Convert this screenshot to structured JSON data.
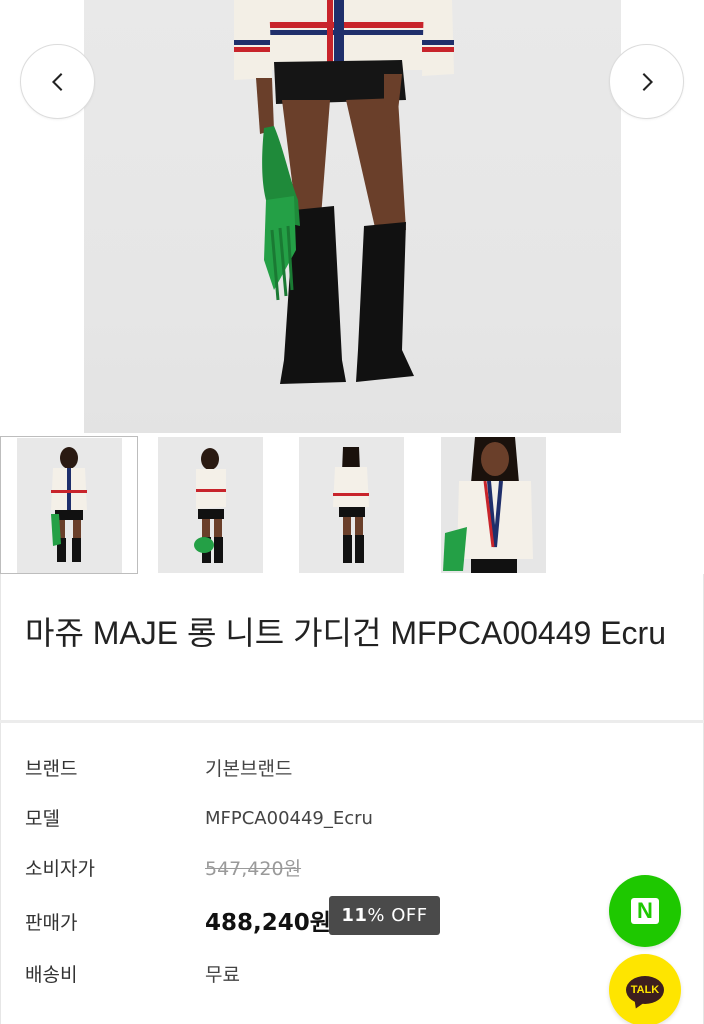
{
  "gallery": {
    "thumbnail_count": 4,
    "selected_index": 0
  },
  "product": {
    "title": "마쥬 MAJE 롱 니트 가디건 MFPCA00449 Ecru"
  },
  "info": {
    "brand_label": "브랜드",
    "brand_value": "기본브랜드",
    "model_label": "모델",
    "model_value": "MFPCA00449_Ecru",
    "msrp_label": "소비자가",
    "msrp_value": "547,420원",
    "price_label": "판매가",
    "price_value": "488,240원",
    "discount_number": "11",
    "discount_suffix": "% OFF",
    "shipping_label": "배송비",
    "shipping_value": "무료"
  },
  "floating": {
    "naver_letter": "N",
    "kakao_label": "TALK"
  },
  "colors": {
    "naver_green": "#1ec800",
    "kakao_yellow": "#fee500",
    "discount_badge": "#4a4a4a"
  },
  "icons": {
    "prev": "chevron-left-icon",
    "next": "chevron-right-icon"
  }
}
